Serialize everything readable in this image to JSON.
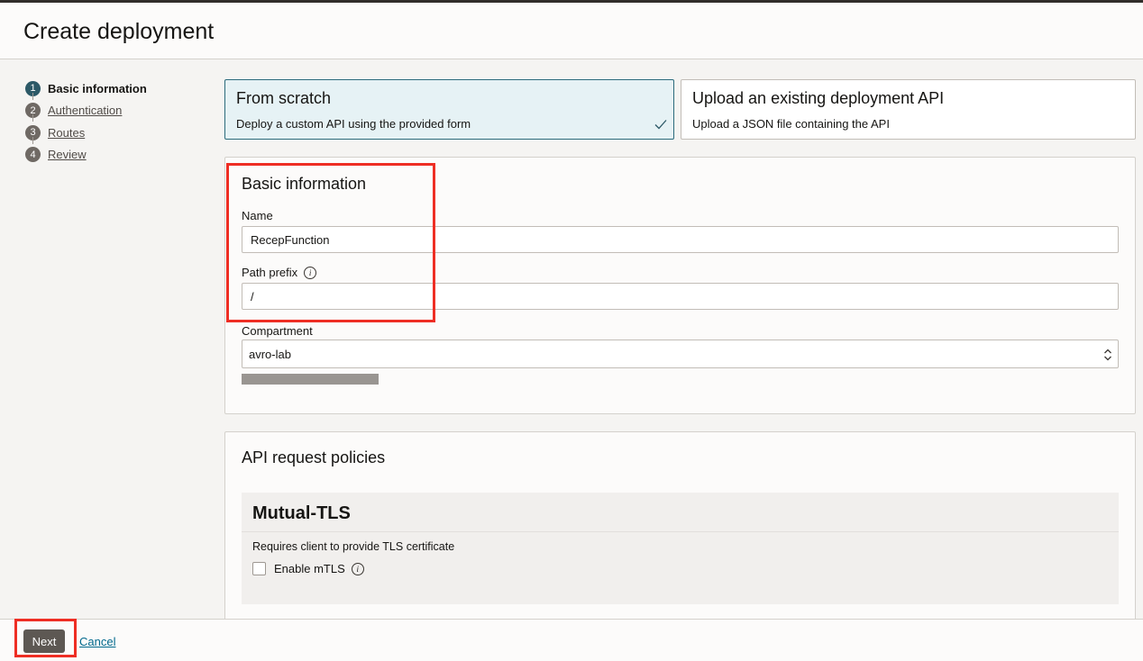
{
  "header": {
    "title": "Create deployment"
  },
  "steps": [
    {
      "number": "1",
      "label": "Basic information",
      "active": true
    },
    {
      "number": "2",
      "label": "Authentication",
      "active": false
    },
    {
      "number": "3",
      "label": "Routes",
      "active": false
    },
    {
      "number": "4",
      "label": "Review",
      "active": false
    }
  ],
  "options": {
    "scratch": {
      "title": "From scratch",
      "description": "Deploy a custom API using the provided form",
      "selected": true
    },
    "upload": {
      "title": "Upload an existing deployment API",
      "description": "Upload a JSON file containing the API",
      "selected": false
    }
  },
  "basic_info": {
    "title": "Basic information",
    "name_label": "Name",
    "name_value": "RecepFunction",
    "path_prefix_label": "Path prefix",
    "path_prefix_value": "/",
    "compartment_label": "Compartment",
    "compartment_value": "avro-lab"
  },
  "policies": {
    "title": "API request policies",
    "mtls_title": "Mutual-TLS",
    "mtls_description": "Requires client to provide TLS certificate",
    "enable_mtls_label": "Enable mTLS"
  },
  "footer": {
    "next_label": "Next",
    "cancel_label": "Cancel"
  },
  "colors": {
    "accent": "#2c5967",
    "highlight": "#ee2e24",
    "link": "#00688c"
  }
}
